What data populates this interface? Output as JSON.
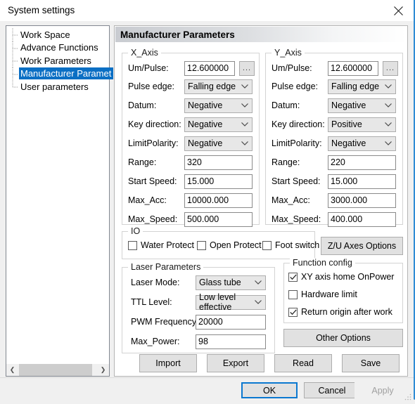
{
  "window": {
    "title": "System settings",
    "close_icon": "close-icon"
  },
  "sidebar": {
    "items": [
      {
        "label": "Work Space",
        "selected": false
      },
      {
        "label": "Advance Functions",
        "selected": false
      },
      {
        "label": "Work Parameters",
        "selected": false
      },
      {
        "label": "Manufacturer Paramet",
        "selected": true
      },
      {
        "label": "User parameters",
        "selected": false
      }
    ],
    "scrollbar": {
      "left_arrow": "❮",
      "right_arrow": "❯"
    }
  },
  "main": {
    "section_title": "Manufacturer Parameters",
    "x_axis": {
      "legend": "X_Axis",
      "fields": [
        {
          "label": "Um/Pulse:",
          "value": "12.600000",
          "type": "text",
          "has_dots": true,
          "dots_label": "..."
        },
        {
          "label": "Pulse edge:",
          "value": "Falling edge",
          "type": "combo"
        },
        {
          "label": "Datum:",
          "value": "Negative",
          "type": "combo"
        },
        {
          "label": "Key direction:",
          "value": "Negative",
          "type": "combo"
        },
        {
          "label": "LimitPolarity:",
          "value": "Negative",
          "type": "combo"
        },
        {
          "label": "Range:",
          "value": "320",
          "type": "text"
        },
        {
          "label": "Start Speed:",
          "value": "15.000",
          "type": "text"
        },
        {
          "label": "Max_Acc:",
          "value": "10000.000",
          "type": "text"
        },
        {
          "label": "Max_Speed:",
          "value": "500.000",
          "type": "text"
        }
      ]
    },
    "y_axis": {
      "legend": "Y_Axis",
      "fields": [
        {
          "label": "Um/Pulse:",
          "value": "12.600000",
          "type": "text",
          "has_dots": true,
          "dots_label": "..."
        },
        {
          "label": "Pulse edge:",
          "value": "Falling edge",
          "type": "combo"
        },
        {
          "label": "Datum:",
          "value": "Negative",
          "type": "combo"
        },
        {
          "label": "Key direction:",
          "value": "Positive",
          "type": "combo"
        },
        {
          "label": "LimitPolarity:",
          "value": "Negative",
          "type": "combo"
        },
        {
          "label": "Range:",
          "value": "220",
          "type": "text"
        },
        {
          "label": "Start Speed:",
          "value": "15.000",
          "type": "text"
        },
        {
          "label": "Max_Acc:",
          "value": "3000.000",
          "type": "text"
        },
        {
          "label": "Max_Speed:",
          "value": "400.000",
          "type": "text"
        }
      ]
    },
    "io": {
      "legend": "IO",
      "checkboxes": [
        {
          "label": "Water Protect",
          "checked": false
        },
        {
          "label": "Open Protect",
          "checked": false
        },
        {
          "label": "Foot switch",
          "checked": false
        }
      ]
    },
    "zu_axes_button": "Z/U Axes Options",
    "laser": {
      "legend": "Laser Parameters",
      "fields": [
        {
          "label": "Laser Mode:",
          "value": "Glass tube",
          "type": "combo"
        },
        {
          "label": "TTL Level:",
          "value": "Low level effective",
          "type": "combo"
        },
        {
          "label": "PWM Frequency:",
          "value": "20000",
          "type": "text"
        },
        {
          "label": "Max_Power:",
          "value": "98",
          "type": "text"
        }
      ]
    },
    "function_config": {
      "legend": "Function config",
      "checkboxes": [
        {
          "label": "XY axis home OnPower",
          "checked": true
        },
        {
          "label": "Hardware limit",
          "checked": false
        },
        {
          "label": "Return origin after work",
          "checked": true
        }
      ]
    },
    "other_options_button": "Other Options",
    "action_buttons": [
      {
        "label": "Import"
      },
      {
        "label": "Export"
      },
      {
        "label": "Read"
      },
      {
        "label": "Save"
      }
    ]
  },
  "footer": {
    "ok": "OK",
    "cancel": "Cancel",
    "apply": "Apply",
    "apply_disabled": true
  },
  "colors": {
    "selection_blue": "#0b6fc4",
    "default_button_border": "#0b78d0",
    "window_accent": "#2e8bd4"
  }
}
